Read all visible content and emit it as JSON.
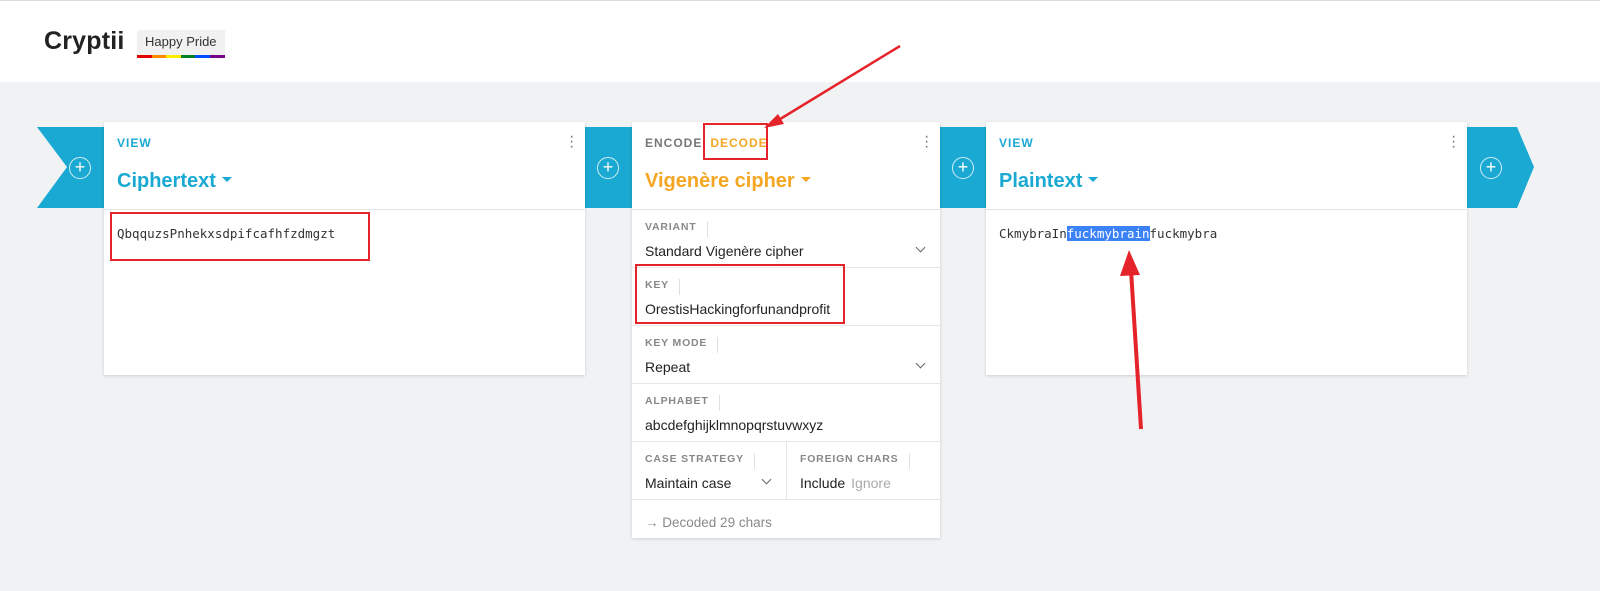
{
  "header": {
    "brand": "Cryptii",
    "badge": "Happy Pride",
    "pride_colors": [
      "#e40303",
      "#ff8c00",
      "#ffed00",
      "#008026",
      "#004dff",
      "#750787"
    ]
  },
  "colors": {
    "accent_blue": "#1aa9d2",
    "accent_orange": "#f5a623",
    "annotation_red": "#e5232a",
    "selection_blue": "#3b82f6"
  },
  "left_card": {
    "tab": "VIEW",
    "title": "Ciphertext",
    "content": "QbqquzsPnhekxsdpifcafhfzdmgzt"
  },
  "middle_card": {
    "tabs": {
      "encode": "ENCODE",
      "decode": "DECODE"
    },
    "title": "Vigenère cipher",
    "variant": {
      "label": "VARIANT",
      "value": "Standard Vigenère cipher"
    },
    "key": {
      "label": "KEY",
      "value": "OrestisHackingforfunandprofit"
    },
    "key_mode": {
      "label": "KEY MODE",
      "value": "Repeat"
    },
    "alphabet": {
      "label": "ALPHABET",
      "value": "abcdefghijklmnopqrstuvwxyz"
    },
    "case_strategy": {
      "label": "CASE STRATEGY",
      "value": "Maintain case"
    },
    "foreign_chars": {
      "label": "FOREIGN CHARS",
      "include": "Include",
      "ignore": "Ignore"
    },
    "status": "Decoded 29 chars"
  },
  "right_card": {
    "tab": "VIEW",
    "title": "Plaintext",
    "content_before": "CkmybraIn",
    "content_selected": "fuckmybrain",
    "content_after": "fuckmybra"
  },
  "pipe": {
    "add_glyph": "+"
  },
  "icons": {
    "menu": "more-vert-icon",
    "add": "add-circle-icon",
    "arrow": "arrow-right-icon",
    "dropdown": "caret-down-icon"
  }
}
